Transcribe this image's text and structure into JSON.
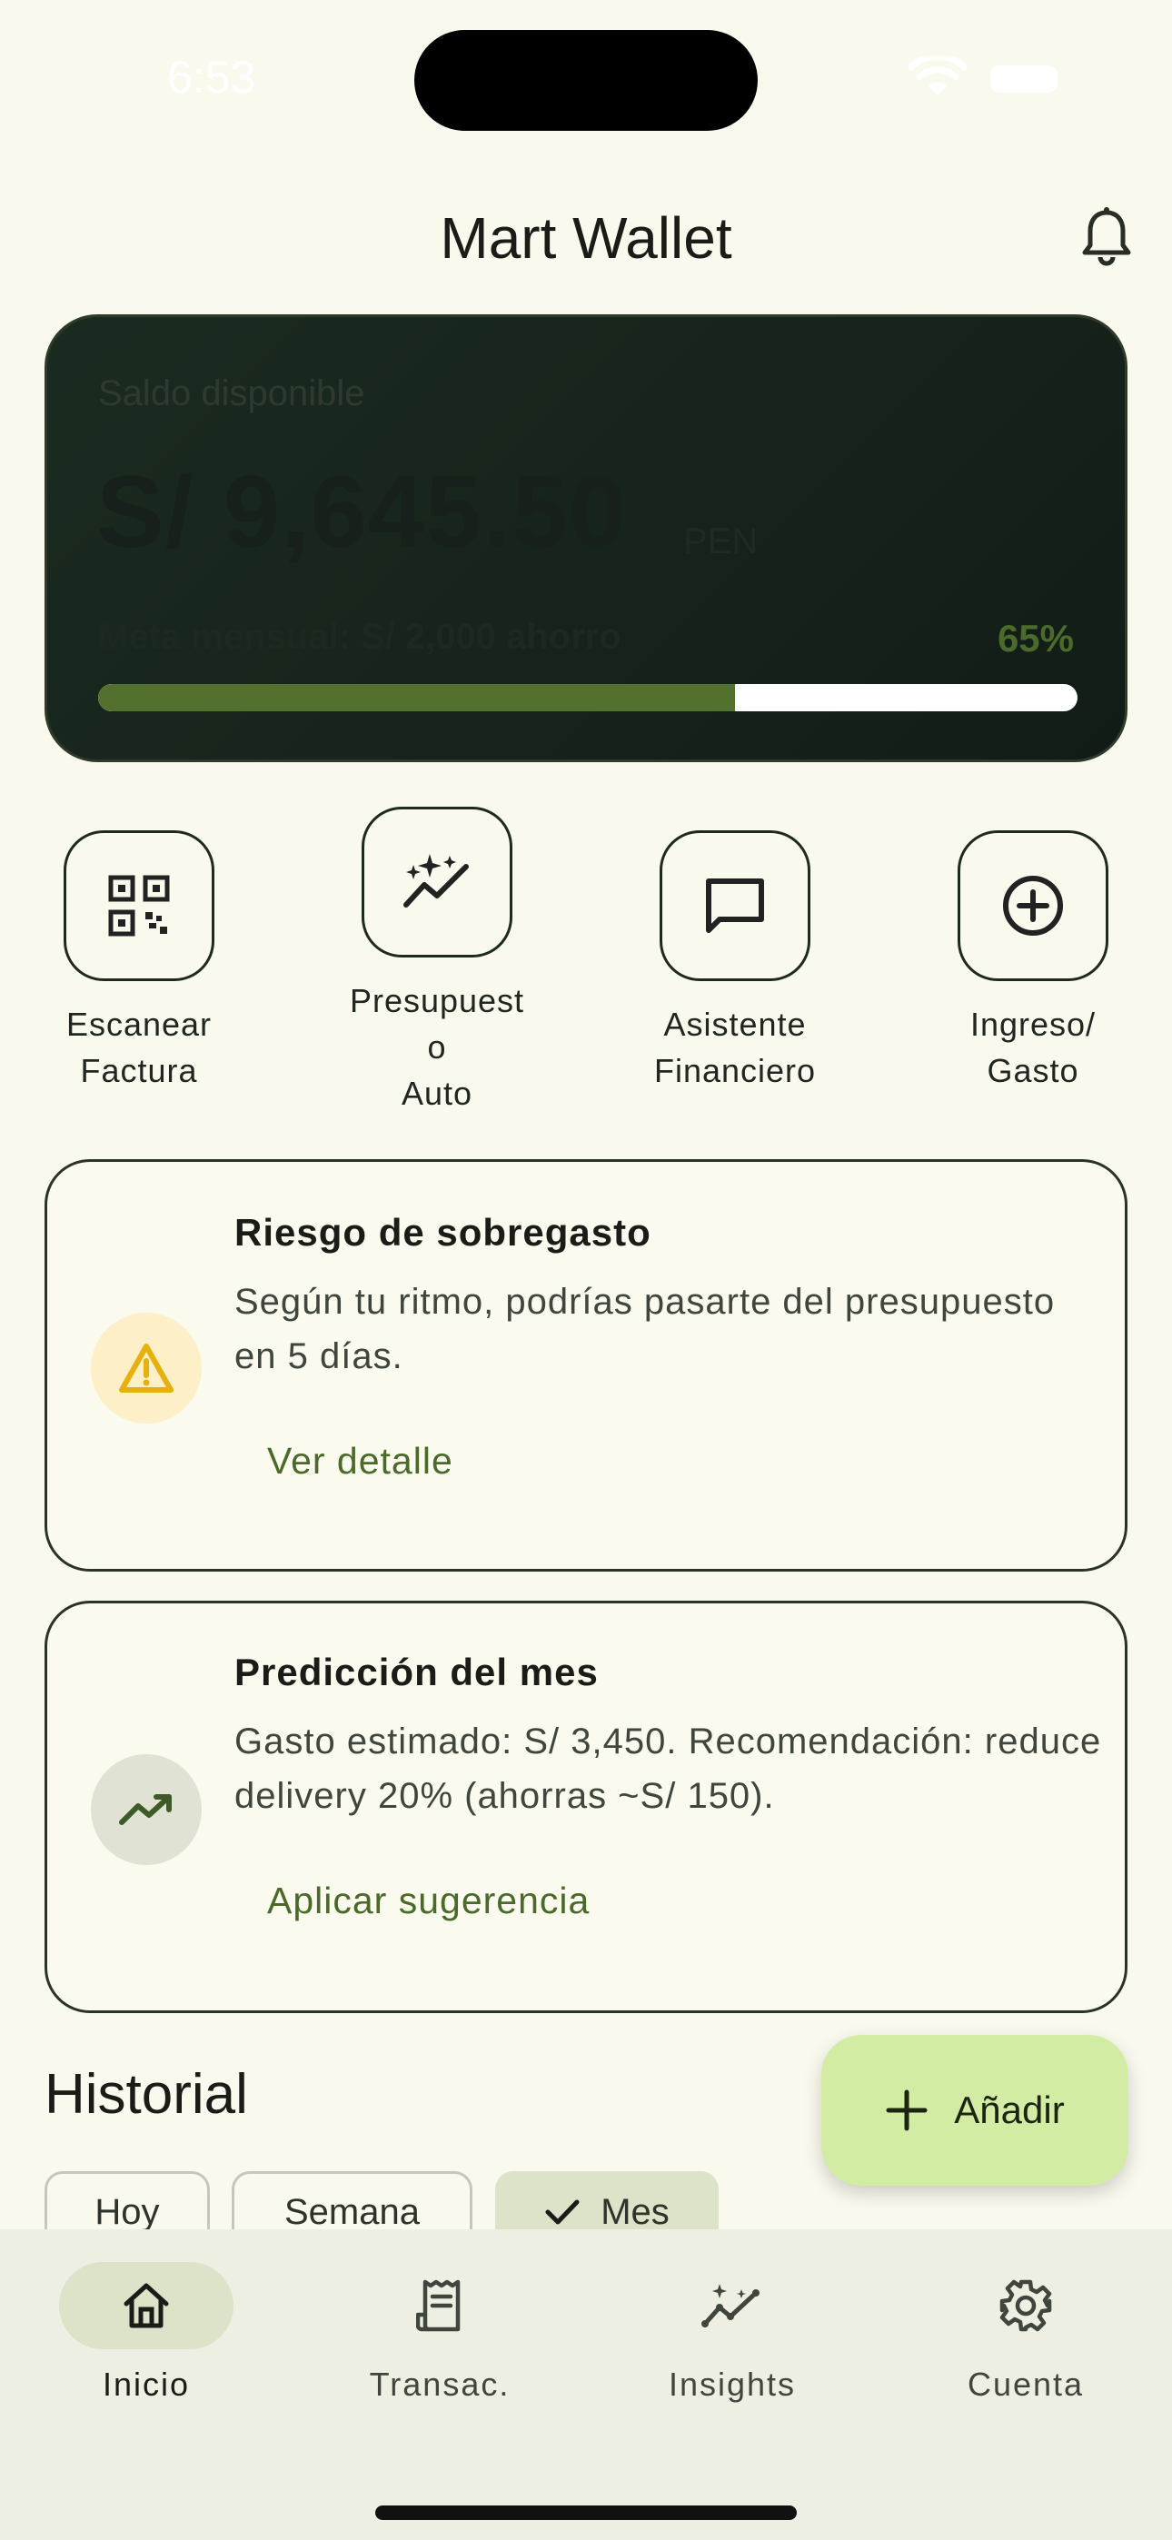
{
  "status_bar": {
    "time": "6:53"
  },
  "header": {
    "title": "Mart Wallet",
    "bell_icon": "bell-icon"
  },
  "balance": {
    "label": "Saldo disponible",
    "amount": "S/ 9,645.50",
    "currency": "PEN",
    "goal_text": "Meta mensual: S/ 2,000 ahorro",
    "goal_percent_label": "65%",
    "goal_progress": 0.65,
    "colors": {
      "fill": "#54702f",
      "track": "#ffffff",
      "card": "#16231b"
    }
  },
  "quick_actions": [
    {
      "label": "Escanear\nFactura",
      "icon": "qr-scan-icon"
    },
    {
      "label": "Presupuest\no\nAuto",
      "icon": "sparkle-trend-icon"
    },
    {
      "label": "Asistente\nFinanciero",
      "icon": "chat-icon"
    },
    {
      "label": "Ingreso/\nGasto",
      "icon": "plus-circle-icon"
    }
  ],
  "alerts": [
    {
      "title": "Riesgo de sobregasto",
      "body": "Según tu ritmo, podrías pasarte del presupuesto en 5 días.",
      "action": "Ver detalle",
      "icon": "warning-icon",
      "icon_bg": "#fdf0c8",
      "icon_color": "#e6b10f"
    },
    {
      "title": "Predicción del mes",
      "body": "Gasto estimado: S/ 3,450. Recomendación: reduce delivery 20% (ahorras ~S/ 150).",
      "action": "Aplicar sugerencia",
      "icon": "trending-up-icon",
      "icon_bg": "#e0e3d3",
      "icon_color": "#4a6a2a"
    }
  ],
  "history": {
    "title": "Historial",
    "chips": [
      {
        "label": "Hoy",
        "selected": false
      },
      {
        "label": "Semana",
        "selected": false
      },
      {
        "label": "Mes",
        "selected": true
      }
    ]
  },
  "fab": {
    "label": "Añadir",
    "icon": "plus-icon"
  },
  "bottom_nav": [
    {
      "label": "Inicio",
      "icon": "home-icon",
      "active": true
    },
    {
      "label": "Transac.",
      "icon": "receipt-icon",
      "active": false
    },
    {
      "label": "Insights",
      "icon": "insights-icon",
      "active": false
    },
    {
      "label": "Cuenta",
      "icon": "gear-icon",
      "active": false
    }
  ]
}
